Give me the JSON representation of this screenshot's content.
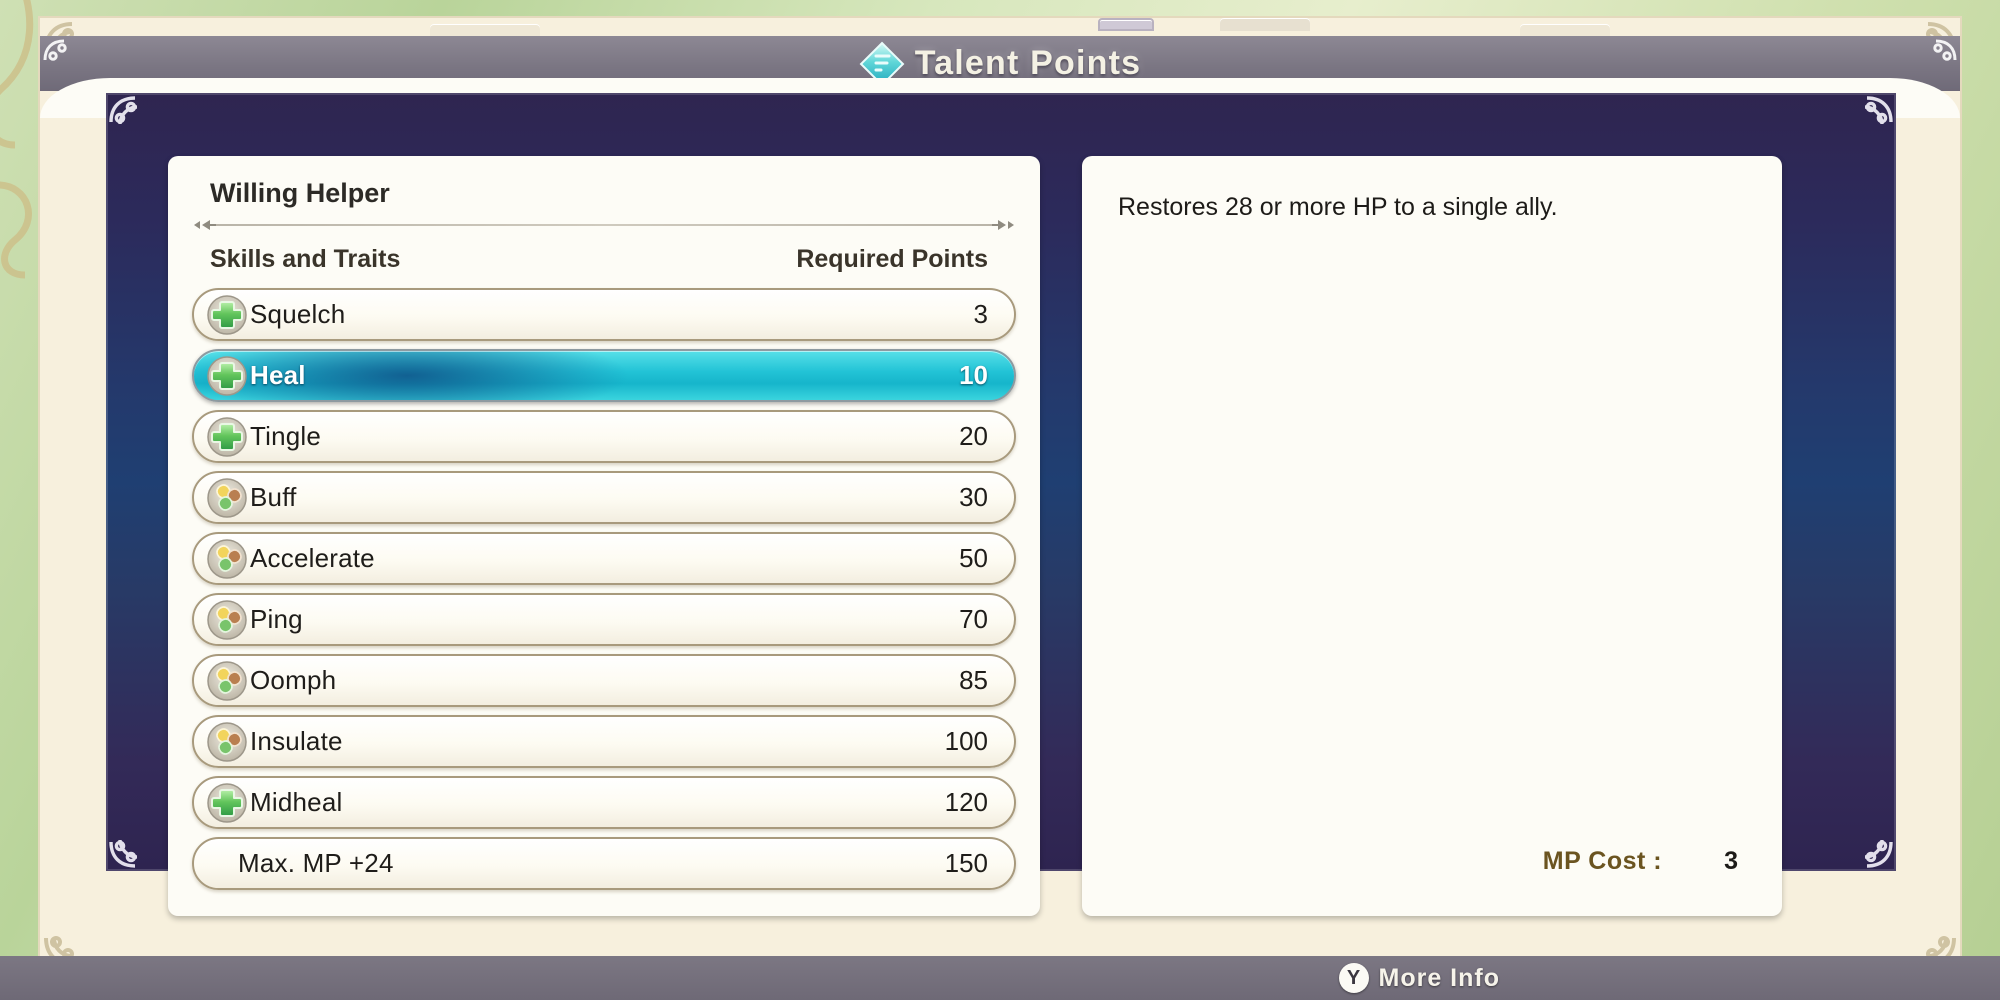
{
  "window": {
    "title": "Talent Points",
    "title_icon": "talent-diamond-icon"
  },
  "panel": {
    "vocation_title": "Willing Helper",
    "columns": {
      "skills": "Skills and Traits",
      "points": "Required Points"
    },
    "rows": [
      {
        "icon": "green-cross-icon",
        "label": "Squelch",
        "points": "3",
        "selected": false
      },
      {
        "icon": "green-cross-icon",
        "label": "Heal",
        "points": "10",
        "selected": true
      },
      {
        "icon": "green-cross-icon",
        "label": "Tingle",
        "points": "20",
        "selected": false
      },
      {
        "icon": "tri-cluster-icon",
        "label": "Buff",
        "points": "30",
        "selected": false
      },
      {
        "icon": "tri-cluster-icon",
        "label": "Accelerate",
        "points": "50",
        "selected": false
      },
      {
        "icon": "tri-cluster-icon",
        "label": "Ping",
        "points": "70",
        "selected": false
      },
      {
        "icon": "tri-cluster-icon",
        "label": "Oomph",
        "points": "85",
        "selected": false
      },
      {
        "icon": "tri-cluster-icon",
        "label": "Insulate",
        "points": "100",
        "selected": false
      },
      {
        "icon": "green-cross-icon",
        "label": "Midheal",
        "points": "120",
        "selected": false
      },
      {
        "icon": "none",
        "label": "Max. MP +24",
        "points": "150",
        "selected": false
      }
    ]
  },
  "description": {
    "text": "Restores 28 or more HP to a single ally.",
    "mp_cost_label": "MP Cost :",
    "mp_cost_value": "3"
  },
  "footer": {
    "button_glyph": "Y",
    "button_label": "More Info"
  },
  "colors": {
    "selected_row": "#22c3d6",
    "panel_purple": "#2f2550",
    "panel_navy": "#1f3f72",
    "card_cream": "#fdfcf6",
    "row_border": "#a89a7d",
    "mp_label_gold": "#6b5420"
  }
}
